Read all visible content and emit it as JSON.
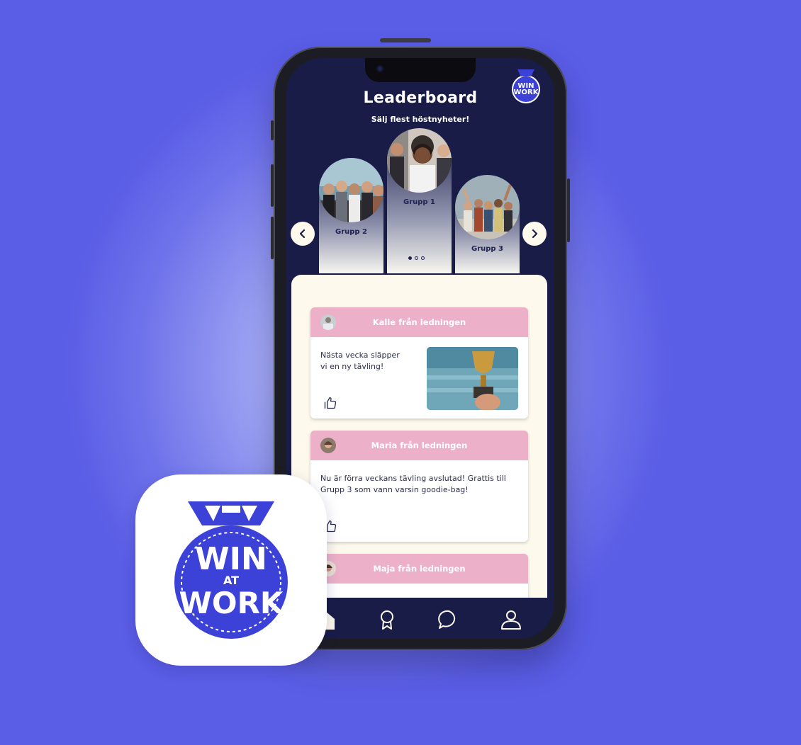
{
  "header": {
    "title": "Leaderboard",
    "subtitle": "Sälj flest höstnyheter!"
  },
  "podium": [
    {
      "label": "Grupp 2",
      "rank": 2
    },
    {
      "label": "Grupp 1",
      "rank": 1
    },
    {
      "label": "Grupp 3",
      "rank": 3
    }
  ],
  "carousel": {
    "page": 1,
    "total": 3,
    "prev_icon": "chevron-left-icon",
    "next_icon": "chevron-right-icon"
  },
  "posts": [
    {
      "author": "Kalle från ledningen",
      "text_line1": "Nästa vecka släpper",
      "text_line2": "vi en ny tävling!"
    },
    {
      "author": "Maria från ledningen",
      "text_line1": "Nu är förra veckans tävling avslutad! Grattis till",
      "text_line2": "Grupp 3 som vann varsin goodie-bag!"
    },
    {
      "author": "Maja från ledningen"
    }
  ],
  "nav": {
    "items": [
      "home-icon",
      "award-icon",
      "chat-icon",
      "profile-icon"
    ]
  },
  "logo": {
    "text_top": "WIN",
    "text_mid": "AT",
    "text_bottom": "WORK"
  },
  "colors": {
    "brand": "#3c41d8",
    "navy": "#191c47",
    "card_header": "#ecb1c9",
    "feed_bg": "#fdf9ec",
    "background": "#5a5de6"
  }
}
